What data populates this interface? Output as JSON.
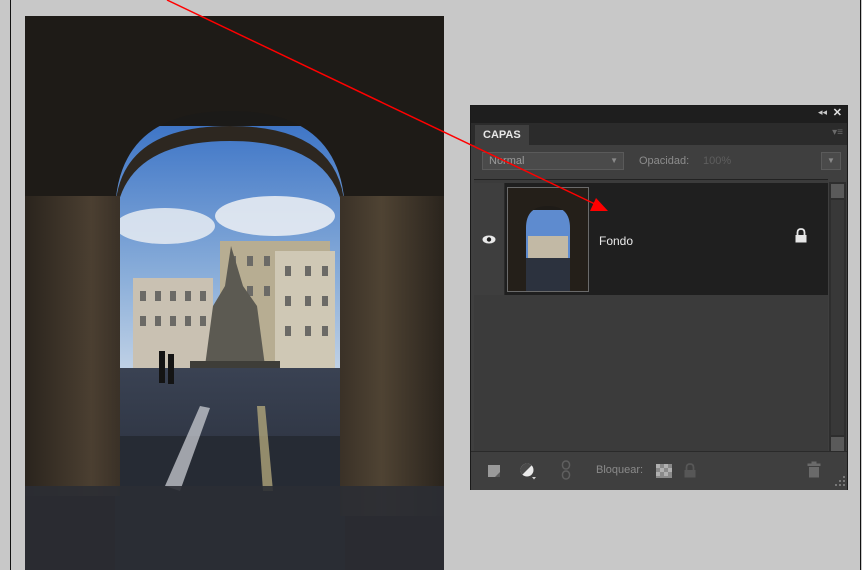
{
  "panel": {
    "tab_label": "CAPAS",
    "collapse_icon": "◂◂",
    "close_icon": "✕",
    "blend_mode": "Normal",
    "opacity_label": "Opacidad:",
    "opacity_value": "100%",
    "layers": [
      {
        "name": "Fondo",
        "visible": true,
        "locked": true
      }
    ],
    "footer": {
      "lock_label": "Bloquear:"
    }
  },
  "colors": {
    "panel_bg": "#3f3f3f",
    "selected_layer_bg": "#1f1f1f",
    "annotation_arrow": "#ff0000",
    "canvas_bg": "#c8c8c8"
  },
  "icons": [
    "eye-icon",
    "lock-icon",
    "new-layer-icon",
    "adjustment-layer-icon",
    "link-icon",
    "lock-transparency-icon",
    "lock-all-icon",
    "trash-icon",
    "resize-grip-icon"
  ]
}
